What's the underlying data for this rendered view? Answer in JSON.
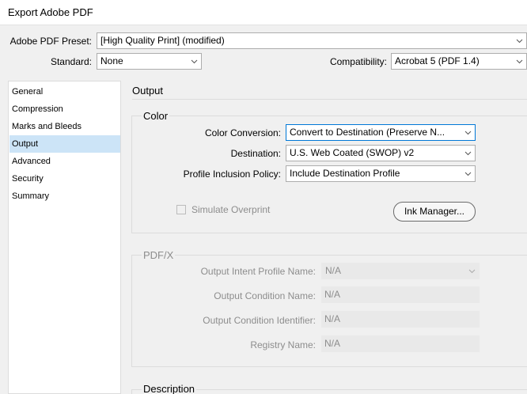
{
  "window": {
    "title": "Export Adobe PDF"
  },
  "preset": {
    "label": "Adobe PDF Preset:",
    "value": "[High Quality Print] (modified)"
  },
  "standard": {
    "label": "Standard:",
    "value": "None"
  },
  "compatibility": {
    "label": "Compatibility:",
    "value": "Acrobat 5 (PDF 1.4)"
  },
  "sidebar": {
    "items": [
      {
        "label": "General"
      },
      {
        "label": "Compression"
      },
      {
        "label": "Marks and Bleeds"
      },
      {
        "label": "Output",
        "selected": true
      },
      {
        "label": "Advanced"
      },
      {
        "label": "Security"
      },
      {
        "label": "Summary"
      }
    ]
  },
  "panel": {
    "title": "Output"
  },
  "color": {
    "group_title": "Color",
    "conversion_label": "Color Conversion:",
    "conversion_value": "Convert to Destination (Preserve N...",
    "destination_label": "Destination:",
    "destination_value": "U.S. Web Coated (SWOP) v2",
    "profile_label": "Profile Inclusion Policy:",
    "profile_value": "Include Destination Profile",
    "simulate_label": "Simulate Overprint",
    "ink_manager_label": "Ink Manager..."
  },
  "pdfx": {
    "group_title": "PDF/X",
    "intent_label": "Output Intent Profile Name:",
    "intent_value": "N/A",
    "condition_name_label": "Output Condition Name:",
    "condition_name_value": "N/A",
    "condition_id_label": "Output Condition Identifier:",
    "condition_id_value": "N/A",
    "registry_label": "Registry Name:",
    "registry_value": "N/A"
  },
  "description": {
    "group_title": "Description"
  },
  "colors": {
    "selected_bg": "#cce4f7",
    "focus_border": "#0078d7"
  }
}
